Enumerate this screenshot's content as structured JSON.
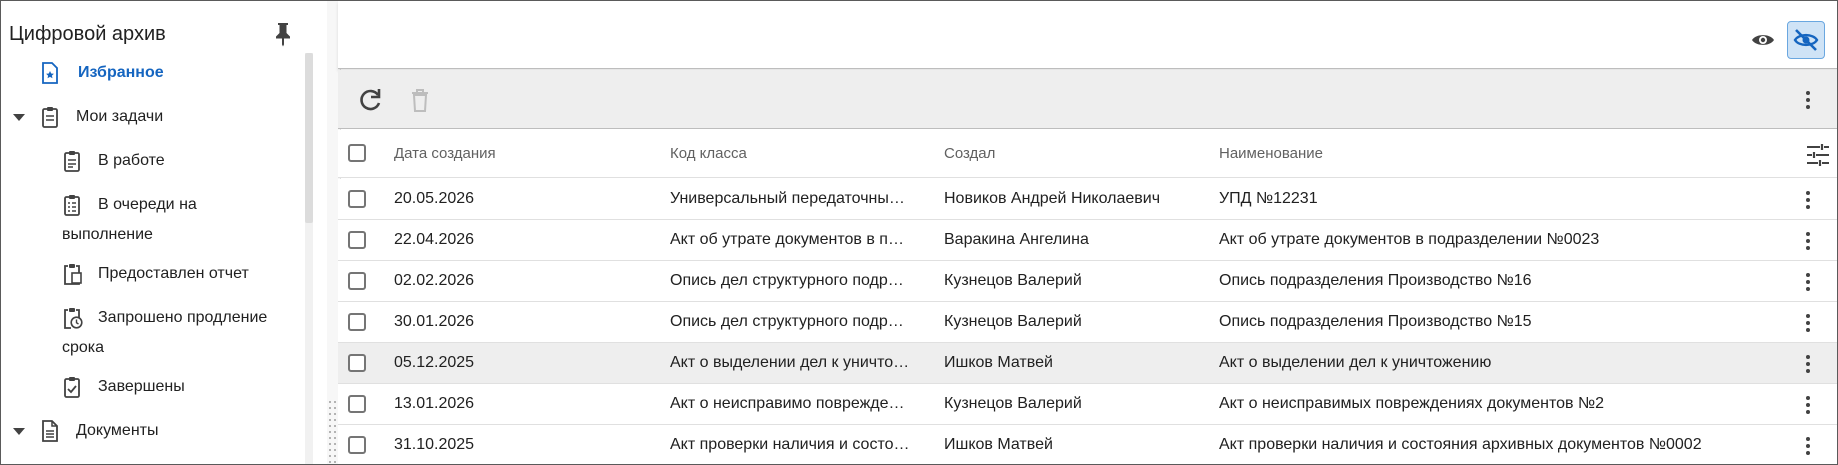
{
  "app": {
    "title": "Цифровой архив"
  },
  "sidebar": {
    "favorites": "Избранное",
    "tasks": {
      "label": "Мои задачи",
      "items": [
        {
          "label_l1": "В работе",
          "label_l2": ""
        },
        {
          "label_l1": "В очереди на",
          "label_l2": "выполнение"
        },
        {
          "label_l1": "Предоставлен отчет",
          "label_l2": ""
        },
        {
          "label_l1": "Запрошено продление",
          "label_l2": "срока"
        },
        {
          "label_l1": "Завершены",
          "label_l2": ""
        }
      ]
    },
    "documents": "Документы"
  },
  "icons": {
    "pin": "pin-icon",
    "eye": "eye-icon",
    "eye_off": "eye-off-icon",
    "refresh": "refresh-icon",
    "delete": "trash-icon",
    "more": "more-vertical-icon",
    "filter": "tune-icon"
  },
  "colors": {
    "accent": "#1565c0",
    "toolbar_bg": "#eeeeee",
    "active_toggle_bg": "#cfe3f6"
  },
  "table": {
    "columns": [
      "Дата создания",
      "Код класса",
      "Создал",
      "Наименование"
    ],
    "rows": [
      {
        "date": "20.05.2026",
        "class": "Универсальный передаточны…",
        "author": "Новиков Андрей Николаевич",
        "name": "УПД №12231"
      },
      {
        "date": "22.04.2026",
        "class": "Акт об утрате документов в п…",
        "author": "Варакина Ангелина",
        "name": "Акт об утрате документов в подразделении №0023"
      },
      {
        "date": "02.02.2026",
        "class": "Опись дел структурного подр…",
        "author": "Кузнецов Валерий",
        "name": "Опись подразделения Производство №16"
      },
      {
        "date": "30.01.2026",
        "class": "Опись дел структурного подр…",
        "author": "Кузнецов Валерий",
        "name": "Опись подразделения Производство №15"
      },
      {
        "date": "05.12.2025",
        "class": "Акт о выделении дел к уничто…",
        "author": "Ишков Матвей",
        "name": "Акт о выделении дел к уничтожению"
      },
      {
        "date": "13.01.2026",
        "class": "Акт о неисправимо поврежде…",
        "author": "Кузнецов Валерий",
        "name": "Акт о неисправимых повреждениях документов №2"
      },
      {
        "date": "31.10.2025",
        "class": "Акт проверки наличия и состо…",
        "author": "Ишков Матвей",
        "name": "Акт проверки наличия и состояния архивных документов №0002"
      }
    ]
  }
}
